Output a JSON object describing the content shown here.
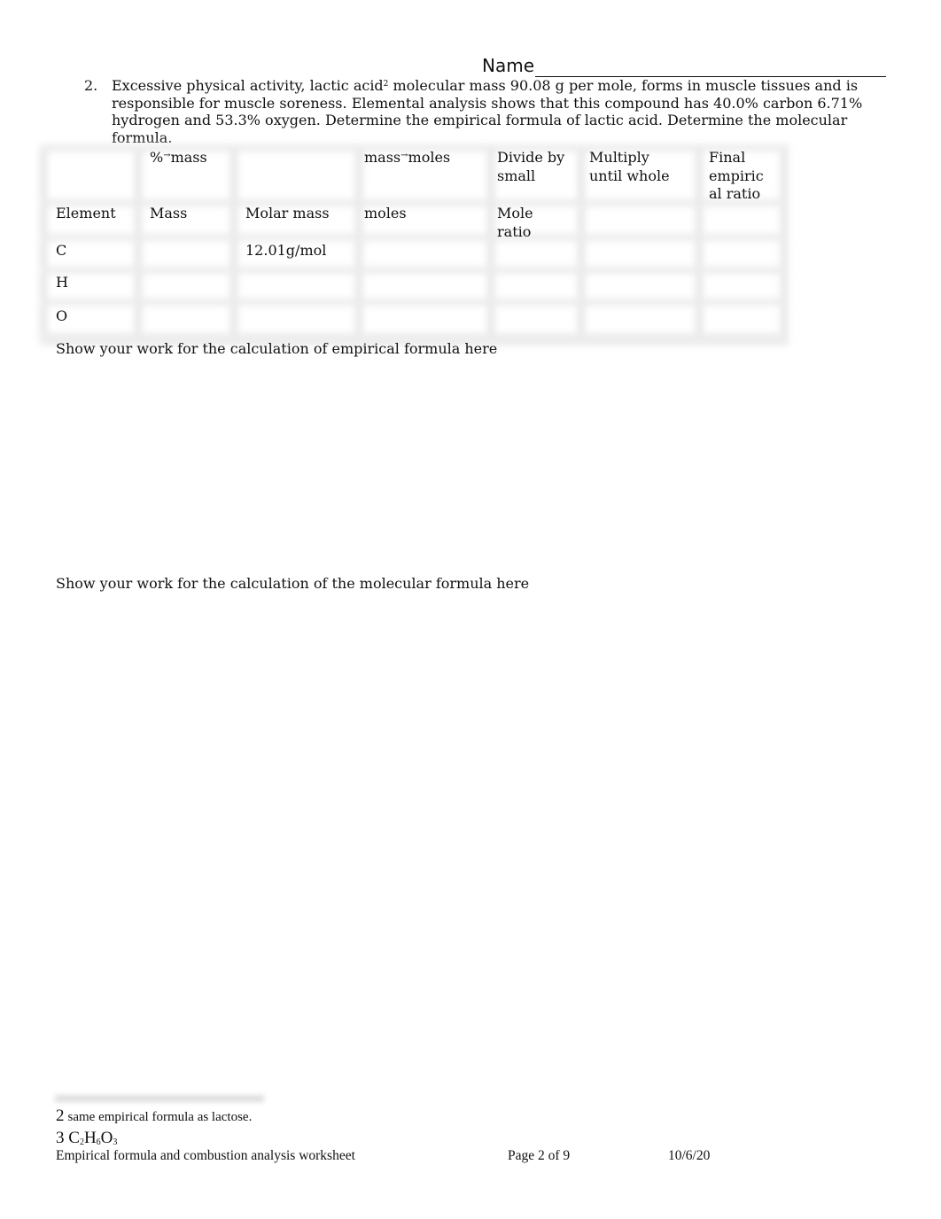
{
  "header": {
    "name_label": "Name"
  },
  "question": {
    "number": "2.",
    "text_before_sup": "Excessive physical activity, lactic acid",
    "footnote_ref": "2",
    "text_after_sup": " molecular mass 90.08 g per mole, forms in muscle tissues and is responsible for muscle soreness. Elemental analysis shows that this compound has 40.0% carbon 6.71% hydrogen and 53.3% oxygen. Determine the empirical formula of lactic acid. Determine the molecular formula."
  },
  "table": {
    "top_headers": [
      "",
      "%→mass",
      "",
      "mass→moles",
      "Divide by\nsmall",
      "Multiply\nuntil whole",
      "Final\nempiric\nal ratio"
    ],
    "top_header_parts": {
      "pct_mass": {
        "a": "%",
        "arrow": "→",
        "b": "mass"
      },
      "mass_moles": {
        "a": "mass",
        "arrow": "→",
        "b": "moles"
      }
    },
    "column_headers": [
      "Element",
      "Mass",
      "Molar mass",
      "moles",
      "Mole\nratio",
      "",
      ""
    ],
    "rows": [
      {
        "element": "C",
        "mass": "",
        "molar_mass": "12.01g/mol",
        "moles": "",
        "mole_ratio": "",
        "multiply": "",
        "final": ""
      },
      {
        "element": "H",
        "mass": "",
        "molar_mass": "",
        "moles": "",
        "mole_ratio": "",
        "multiply": "",
        "final": ""
      },
      {
        "element": "O",
        "mass": "",
        "molar_mass": "",
        "moles": "",
        "mole_ratio": "",
        "multiply": "",
        "final": ""
      }
    ]
  },
  "work_sections": {
    "empirical": "Show your work for the calculation of empirical formula here",
    "molecular": "Show your work for the calculation of the molecular formula here"
  },
  "footnotes": [
    {
      "number": "2",
      "text": "same empirical formula as lactose."
    },
    {
      "number": "3",
      "formula": [
        {
          "el": "C",
          "sub": "2"
        },
        {
          "el": "H",
          "sub": "6"
        },
        {
          "el": "O",
          "sub": "3"
        }
      ]
    }
  ],
  "footer": {
    "title": "Empirical formula and combustion analysis worksheet",
    "page": "Page 2 of 9",
    "date": "10/6/20"
  }
}
